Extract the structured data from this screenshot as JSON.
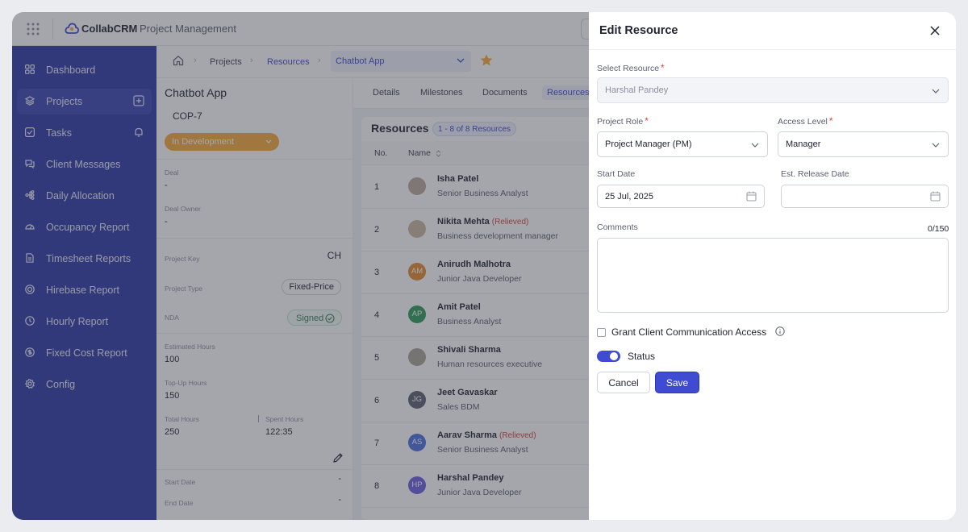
{
  "app": {
    "brand": "CollabCRM",
    "product": "Project Management"
  },
  "sidebar": {
    "items": [
      {
        "label": "Dashboard",
        "icon": "dashboard-icon",
        "active": false
      },
      {
        "label": "Projects",
        "icon": "layers-icon",
        "active": true
      },
      {
        "label": "Tasks",
        "icon": "checkbox-icon",
        "active": false
      },
      {
        "label": "Client Messages",
        "icon": "chat-icon",
        "active": false
      },
      {
        "label": "Daily Allocation",
        "icon": "hierarchy-icon",
        "active": false
      },
      {
        "label": "Occupancy Report",
        "icon": "gauge-icon",
        "active": false
      },
      {
        "label": "Timesheet Reports",
        "icon": "document-icon",
        "active": false
      },
      {
        "label": "Hirebase Report",
        "icon": "target-icon",
        "active": false
      },
      {
        "label": "Hourly Report",
        "icon": "clock-icon",
        "active": false
      },
      {
        "label": "Fixed Cost Report",
        "icon": "coin-icon",
        "active": false
      },
      {
        "label": "Config",
        "icon": "gear-icon",
        "active": false
      }
    ]
  },
  "breadcrumb": {
    "home_icon": "home-icon",
    "items": [
      "Projects",
      "Resources"
    ],
    "selected_project": "Chatbot App"
  },
  "project": {
    "name": "Chatbot App",
    "code": "COP-7",
    "status": "In Development",
    "deal_label": "Deal",
    "deal_value": "-",
    "deal_owner_label": "Deal Owner",
    "deal_owner_value": "-",
    "project_key_label": "Project Key",
    "project_key_value": "CH",
    "project_type_label": "Project Type",
    "project_type_value": "Fixed-Price",
    "nda_label": "NDA",
    "nda_value": "Signed",
    "estimated_hours_label": "Estimated Hours",
    "estimated_hours_value": "100",
    "topup_hours_label": "Top-Up Hours",
    "topup_hours_value": "150",
    "total_hours_label": "Total Hours",
    "total_hours_value": "250",
    "spent_hours_label": "Spent Hours",
    "spent_hours_value": "122:35",
    "start_date_label": "Start Date",
    "start_date_value": "-",
    "end_date_label": "End Date",
    "end_date_value": "-"
  },
  "tabs": [
    "Details",
    "Milestones",
    "Documents",
    "Resources"
  ],
  "resources": {
    "title": "Resources",
    "count": "1 - 8 of 8 Resources",
    "col_no": "No.",
    "col_name": "Name",
    "rows": [
      {
        "no": "1",
        "name": "Isha Patel",
        "relieved": "",
        "role": "Senior Business Analyst",
        "initials": "",
        "color": "#b8a99a"
      },
      {
        "no": "2",
        "name": "Nikita Mehta",
        "relieved": "(Relieved)",
        "role": "Business development manager",
        "initials": "",
        "color": "#c9b7a0"
      },
      {
        "no": "3",
        "name": "Anirudh Malhotra",
        "relieved": "",
        "role": "Junior Java Developer",
        "initials": "AM",
        "color": "#e58a2e"
      },
      {
        "no": "4",
        "name": "Amit Patel",
        "relieved": "",
        "role": "Business Analyst",
        "initials": "AP",
        "color": "#2e9b5b"
      },
      {
        "no": "5",
        "name": "Shivali Sharma",
        "relieved": "",
        "role": "Human resources executive",
        "initials": "",
        "color": "#a9a29a"
      },
      {
        "no": "6",
        "name": "Jeet Gavaskar",
        "relieved": "",
        "role": "Sales BDM",
        "initials": "JG",
        "color": "#5b6070"
      },
      {
        "no": "7",
        "name": "Aarav Sharma",
        "relieved": "(Relieved)",
        "role": "Senior Business Analyst",
        "initials": "AS",
        "color": "#4a6fe0"
      },
      {
        "no": "8",
        "name": "Harshal Pandey",
        "relieved": "",
        "role": "Junior Java Developer",
        "initials": "HP",
        "color": "#6b5fe0"
      }
    ]
  },
  "drawer": {
    "title": "Edit Resource",
    "select_resource_label": "Select Resource",
    "select_resource_value": "Harshal Pandey",
    "project_role_label": "Project Role",
    "project_role_value": "Project Manager (PM)",
    "access_level_label": "Access Level",
    "access_level_value": "Manager",
    "start_date_label": "Start Date",
    "start_date_value": "25 Jul, 2025",
    "release_date_label": "Est. Release Date",
    "release_date_value": "",
    "comments_label": "Comments",
    "comments_counter": "0/150",
    "required_mark": "*",
    "grant_label": "Grant Client Communication Access",
    "status_label": "Status",
    "status_on": true,
    "cancel_label": "Cancel",
    "save_label": "Save"
  },
  "colors": {
    "sidebar": "#2f3aa6",
    "accent": "#3f4bd0",
    "status_pill": "#f6a93a",
    "required": "#e0463c",
    "relieved": "#d14343"
  }
}
